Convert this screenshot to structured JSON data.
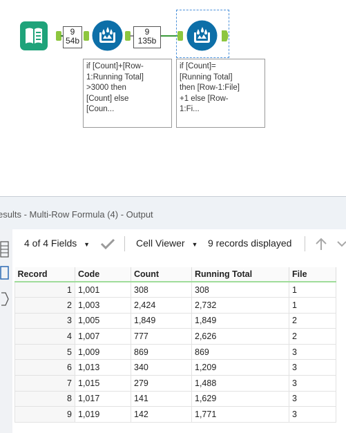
{
  "workflow": {
    "connection_1": {
      "records": "9",
      "size": "54b"
    },
    "connection_2": {
      "records": "9",
      "size": "135b"
    },
    "annotation_1": "if [Count]+[Row-\n1:Running Total]\n>3000 then\n[Count] else\n[Coun...",
    "annotation_2": "if [Count]=\n[Running Total]\nthen [Row-1:File]\n+1 else [Row-\n1:Fi..."
  },
  "results": {
    "title": "esults - Multi-Row Formula (4) - Output",
    "fields_label": "4 of 4 Fields",
    "viewer_label": "Cell Viewer",
    "records_label": "9 records displayed",
    "columns": [
      "Record",
      "Code",
      "Count",
      "Running Total",
      "File"
    ],
    "rows": [
      [
        "1",
        "1,001",
        "308",
        "308",
        "1"
      ],
      [
        "2",
        "1,003",
        "2,424",
        "2,732",
        "1"
      ],
      [
        "3",
        "1,005",
        "1,849",
        "1,849",
        "2"
      ],
      [
        "4",
        "1,007",
        "777",
        "2,626",
        "2"
      ],
      [
        "5",
        "1,009",
        "869",
        "869",
        "3"
      ],
      [
        "6",
        "1,013",
        "340",
        "1,209",
        "3"
      ],
      [
        "7",
        "1,015",
        "279",
        "1,488",
        "3"
      ],
      [
        "8",
        "1,017",
        "141",
        "1,629",
        "3"
      ],
      [
        "9",
        "1,019",
        "142",
        "1,771",
        "3"
      ]
    ]
  },
  "colors": {
    "input_tool": "#1fa37a",
    "formula_tool": "#0d6fa8",
    "anchor": "#8dc63f",
    "header_underline": "#9fdc9a"
  },
  "icons": {
    "input_tool": "book-icon",
    "formula_tool": "multi-row-formula-icon",
    "dropdown": "caret-down-icon",
    "apply": "checkmark-icon",
    "sort_up": "arrow-up-icon",
    "sort_down": "chevron-down-icon"
  }
}
